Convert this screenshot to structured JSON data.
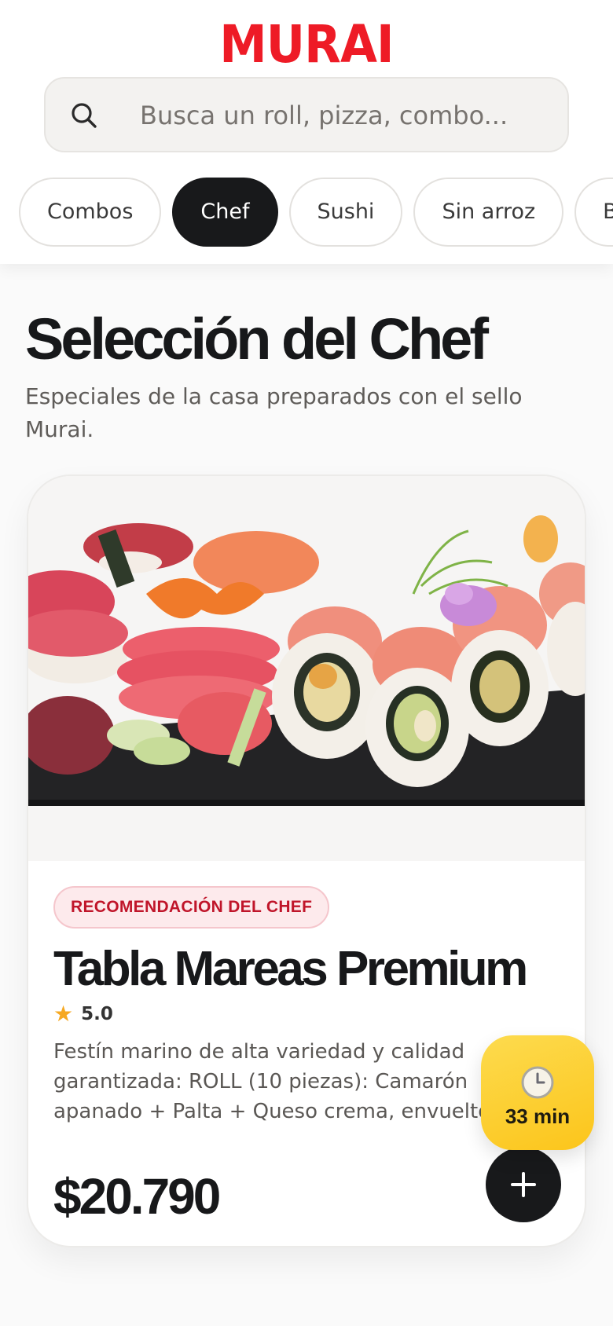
{
  "brand": {
    "name": "MURAI",
    "color": "#ee1b26"
  },
  "search": {
    "placeholder": "Busca un roll, pizza, combo...",
    "value": "",
    "icon": "search-icon"
  },
  "categories": [
    {
      "label": "Combos",
      "active": false
    },
    {
      "label": "Chef",
      "active": true
    },
    {
      "label": "Sushi",
      "active": false
    },
    {
      "label": "Sin arroz",
      "active": false
    },
    {
      "label": "B",
      "active": false
    }
  ],
  "section": {
    "title": "Selección del Chef",
    "subtitle": "Especiales de la casa preparados con el sello Murai."
  },
  "product": {
    "badge": "RECOMENDACIÓN DEL CHEF",
    "title": "Tabla Mareas Premium",
    "rating": "5.0",
    "description": "Festín marino de alta variedad y calidad garantizada: ROLL (10 piezas): Camarón apanado + Palta + Queso crema, envuelto",
    "price": "$20.790",
    "add_icon": "plus-icon"
  },
  "delivery": {
    "time": "33 min",
    "icon": "clock-icon",
    "color": "#fcc51b"
  }
}
